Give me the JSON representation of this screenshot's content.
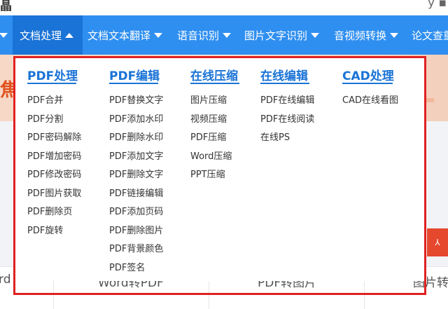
{
  "header": {
    "logo_fragment": "晶",
    "user_fragment": "y  ▪"
  },
  "nav": {
    "items": [
      {
        "label": "文档处理",
        "active": true
      },
      {
        "label": "文档文本翻译",
        "active": false
      },
      {
        "label": "语音识别",
        "active": false
      },
      {
        "label": "图片文字识别",
        "active": false
      },
      {
        "label": "音视频转换",
        "active": false
      },
      {
        "label": "论文查重",
        "active": false
      }
    ]
  },
  "background": {
    "banner_fragment": "焦",
    "tiles": [
      "rd",
      "Word转PDF",
      "PDF转图片",
      "图片转"
    ],
    "pdf_icon_text": "⅄"
  },
  "dropdown": {
    "columns": [
      {
        "title": "PDF处理",
        "items": [
          "PDF合并",
          "PDF分割",
          "PDF密码解除",
          "PDF增加密码",
          "PDF修改密码",
          "PDF图片获取",
          "PDF删除页",
          "PDF旋转"
        ]
      },
      {
        "title": "PDF编辑",
        "items": [
          "PDF替换文字",
          "PDF添加水印",
          "PDF删除水印",
          "PDF添加文字",
          "PDF删除文字",
          "PDF链接编辑",
          "PDF添加页码",
          "PDF删除图片",
          "PDF背景颜色",
          "PDF签名"
        ]
      },
      {
        "title": "在线压缩",
        "items": [
          "图片压缩",
          "视频压缩",
          "PDF压缩",
          "Word压缩",
          "PPT压缩"
        ]
      },
      {
        "title": "在线编辑",
        "items": [
          "PDF在线编辑",
          "PDF在线阅读",
          "在线PS"
        ]
      },
      {
        "title": "CAD处理",
        "items": [
          "CAD在线看图"
        ]
      }
    ]
  },
  "colors": {
    "nav_bg": "#2f8ff0",
    "nav_active_bg": "#1a73d6",
    "title_blue": "#1a73d6",
    "highlight_red": "#e02020"
  }
}
